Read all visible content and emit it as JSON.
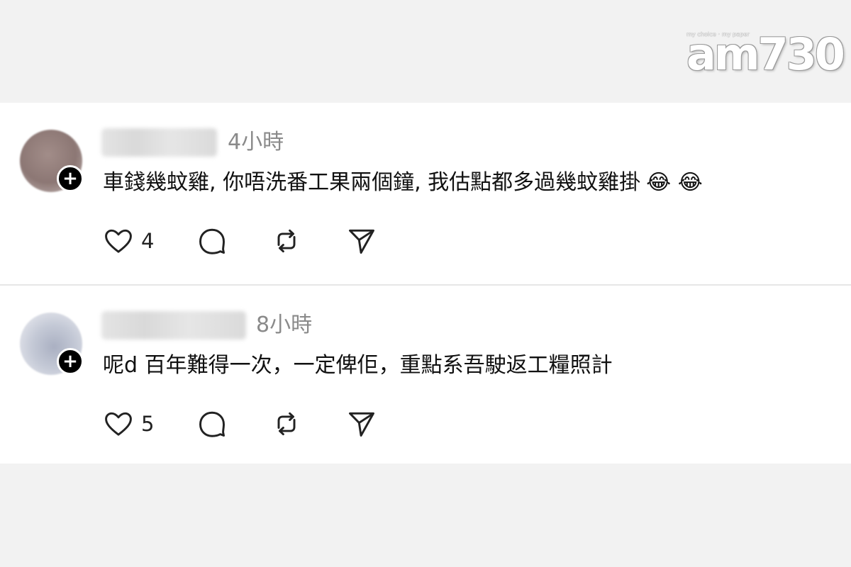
{
  "logo": {
    "text": "am730",
    "tagline": "my choice · my paper"
  },
  "comments": [
    {
      "time": "4小時",
      "text": "車錢幾蚊雞, 你唔洗番工果兩個鐘, 我估點都多過幾蚊雞掛",
      "emoji": "😂 😂",
      "likes": "4",
      "avatar_icon": "avatar-blurred"
    },
    {
      "time": "8小時",
      "text": "呢d 百年難得一次，一定俾佢，重點系吾駛返工糧照計",
      "emoji": "",
      "likes": "5",
      "avatar_icon": "avatar-blurred"
    }
  ],
  "icons": {
    "follow": "plus-icon",
    "like": "heart-icon",
    "reply": "comment-icon",
    "repost": "repost-icon",
    "share": "send-icon"
  }
}
